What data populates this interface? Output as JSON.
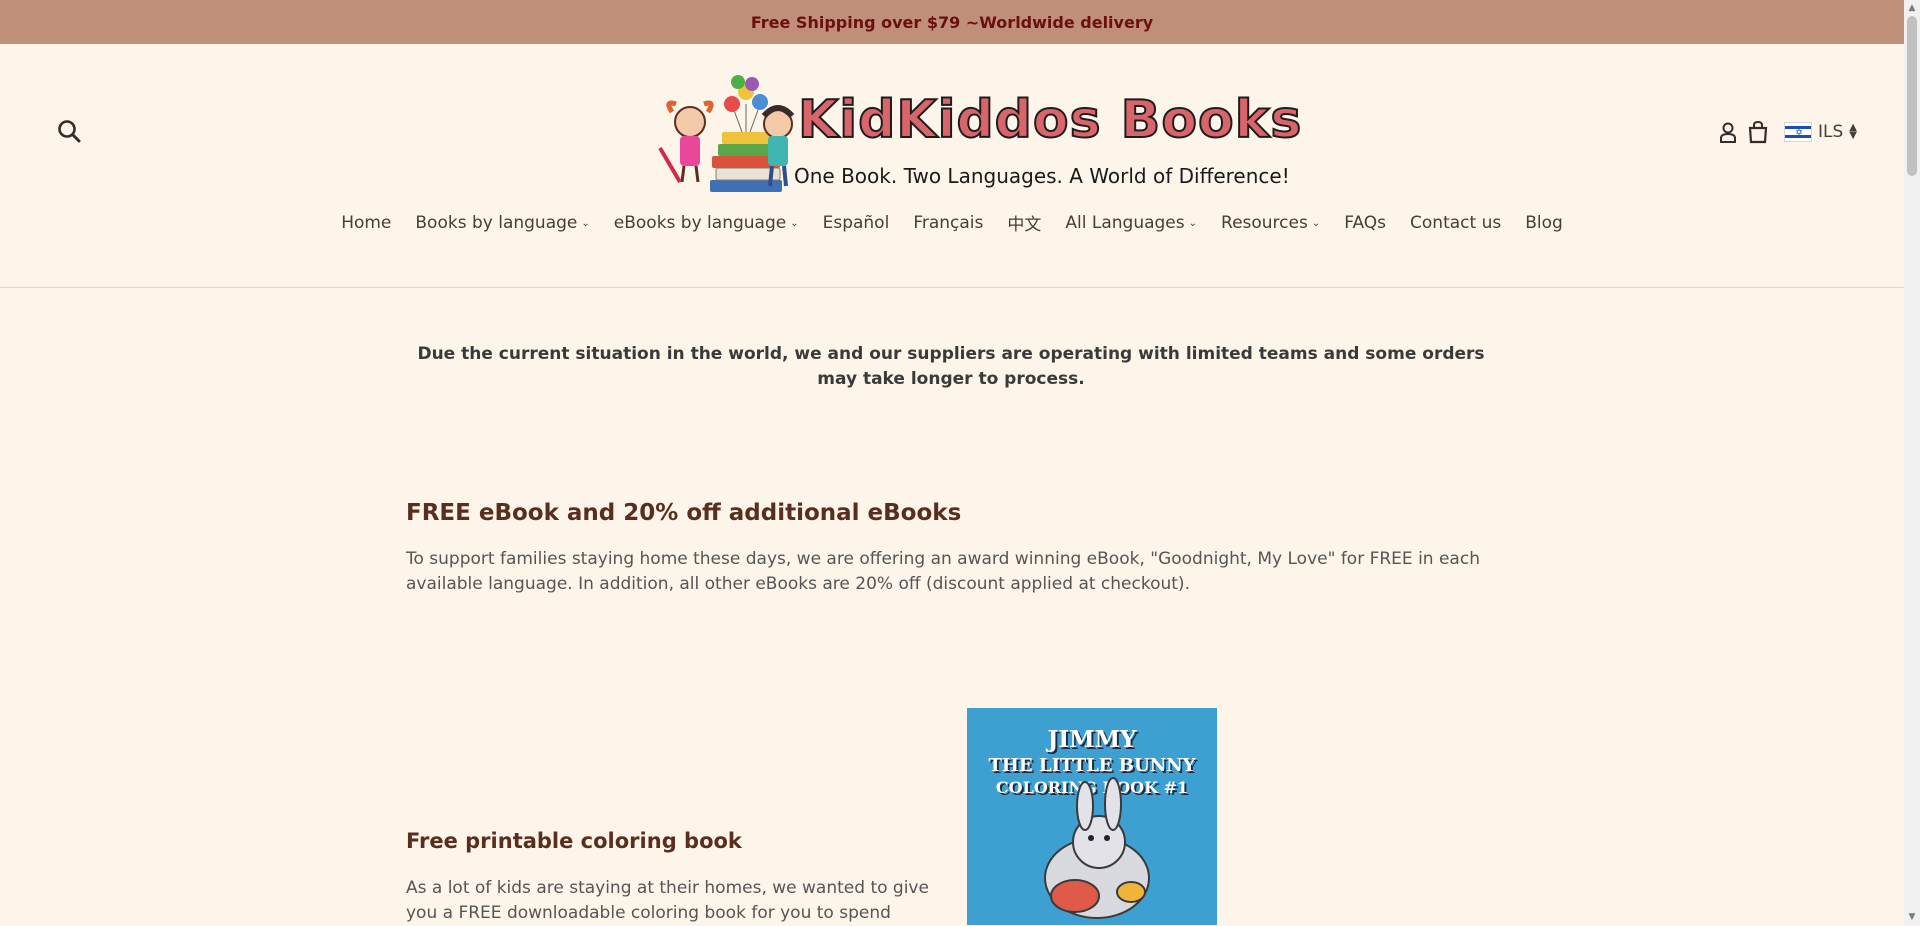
{
  "announcement": {
    "text": "Free Shipping over $79 ~Worldwide delivery"
  },
  "header": {
    "logo": {
      "brand": "KidKiddos Books",
      "tagline": "One Book. Two Languages. A World of Difference!"
    },
    "icons": {
      "search": "search-icon",
      "account": "account-icon",
      "cart": "cart-icon"
    },
    "currency": {
      "code": "ILS",
      "flag": "israel-flag"
    }
  },
  "nav": {
    "items": [
      {
        "label": "Home",
        "dropdown": false
      },
      {
        "label": "Books by language",
        "dropdown": true
      },
      {
        "label": "eBooks by language",
        "dropdown": true
      },
      {
        "label": "Español",
        "dropdown": false
      },
      {
        "label": "Français",
        "dropdown": false
      },
      {
        "label": "中文",
        "dropdown": false
      },
      {
        "label": "All Languages",
        "dropdown": true
      },
      {
        "label": "Resources",
        "dropdown": true
      },
      {
        "label": "FAQs",
        "dropdown": false
      },
      {
        "label": "Contact us",
        "dropdown": false
      },
      {
        "label": "Blog",
        "dropdown": false
      }
    ],
    "caret": "⌄"
  },
  "notice": {
    "text": "Due the current situation in the world, we and our suppliers are operating with limited teams and some orders may take longer to process."
  },
  "sections": [
    {
      "title": "FREE eBook and 20% off additional eBooks",
      "body": "To support families staying home these days, we are offering an award winning eBook, \"Goodnight, My Love\" for FREE in each available language. In addition, all other eBooks are 20% off (discount applied at checkout)."
    },
    {
      "title": "Free printable coloring book",
      "body": "As a lot of kids are staying at their homes, we wanted to give you a FREE downloadable coloring book for you to spend"
    }
  ],
  "bookcover": {
    "line1": "JIMMY",
    "line2": "THE LITTLE BUNNY",
    "line3": "COLORING BOOK #1"
  },
  "colors": {
    "background": "#fdf5ea",
    "announcement_bg": "#bf8f79",
    "announcement_text": "#6b0f0f",
    "heading": "#5a2e1f",
    "cover_bg": "#3da0d0"
  }
}
